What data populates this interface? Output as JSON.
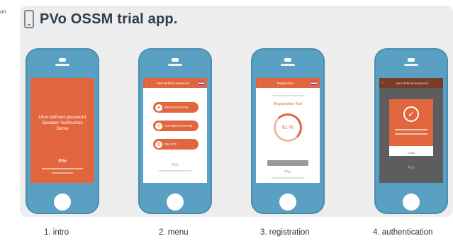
{
  "edge_text": "on",
  "title": "PVo OSSM trial app.",
  "icons": {
    "title": "phone-outline-icon",
    "back": "chevron-left-icon",
    "flag": "flag-icon",
    "mic": "microphone-icon",
    "fingerprint": "fingerprint-icon",
    "trash": "trash-icon",
    "check": "check-circle-icon"
  },
  "colors": {
    "accent": "#e2663d",
    "phone_body": "#5aa0c2",
    "panel": "#ededed"
  },
  "phones": [
    {
      "caption": "1. intro",
      "screen": {
        "lines": [
          "User-defined password",
          "Speaker Verification",
          "Demo"
        ],
        "brand": "PVo"
      }
    },
    {
      "caption": "2. menu",
      "screen": {
        "header": "User-defined password",
        "buttons": [
          "REGISTRATION",
          "AUTHENTICATION",
          "DELETE"
        ],
        "brand": "PVo"
      }
    },
    {
      "caption": "3. registration",
      "screen": {
        "header": "Registration",
        "subtitle": "Registration Test",
        "progress_percent": 61,
        "progress_label": "61 %",
        "brand": "PVo"
      }
    },
    {
      "caption": "4. authentication",
      "screen": {
        "header": "User-defined password",
        "dialog_button": "Close",
        "brand": "PVo"
      }
    }
  ]
}
